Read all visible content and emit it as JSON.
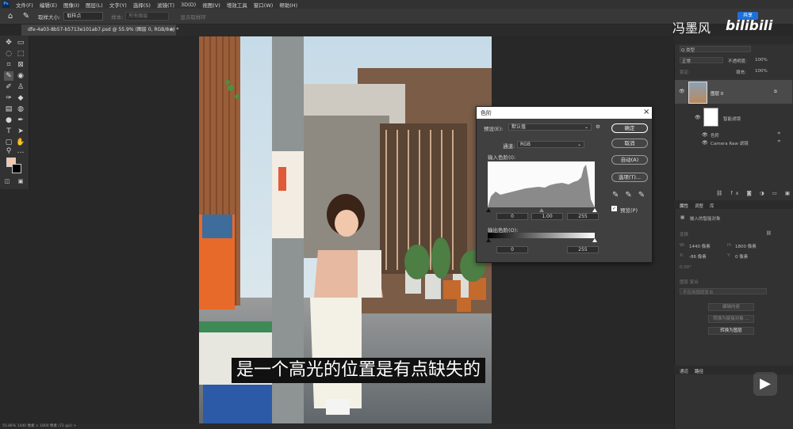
{
  "menubar": {
    "logo": "Ps",
    "items": [
      "文件(F)",
      "编辑(E)",
      "图像(I)",
      "图层(L)",
      "文字(Y)",
      "选择(S)",
      "滤镜(T)",
      "3D(D)",
      "视图(V)",
      "增效工具",
      "窗口(W)",
      "帮助(H)"
    ]
  },
  "options": {
    "sample_size_label": "取样大小:",
    "sample_size_value": "取样点",
    "sample_label": "样本:",
    "sample_value": "所有图层",
    "show_ring": "显示取样环"
  },
  "watermark": {
    "author": "冯墨风",
    "platform": "bilibili",
    "share": "共享"
  },
  "document": {
    "tab": "dfe-4a03-8b57-b5713e101ab7.psd @ 55.9% (图层 0, RGB/8#) *",
    "close": "×"
  },
  "subtitle": "是一个高光的位置是有点缺失的",
  "statusbar": "55.86%   1440 像素 × 1800 像素 (72 ppi)   >",
  "layers": {
    "search_label": "Q 类型",
    "blend_mode": "正常",
    "opacity_label": "不透明度:",
    "opacity_value": "100%",
    "lock_label": "锁定:",
    "fill_label": "填充:",
    "fill_value": "100%",
    "layer_name": "图层 0",
    "smart_filter": "智能滤镜",
    "filter_1": "色阶",
    "filter_2": "Camera Raw 滤镜"
  },
  "properties": {
    "tabs": [
      "属性",
      "调整",
      "库"
    ],
    "object_label": "嵌入的智能对象",
    "transform_label": "变换",
    "w_label": "W:",
    "w_value": "1440 像素",
    "h_label": "H:",
    "h_value": "1800 像素",
    "x_label": "X:",
    "x_value": "-86 像素",
    "y_label": "Y:",
    "y_value": "0 像素",
    "angle_value": "0.00°",
    "comp_label": "图层 复合",
    "comp_value": "不应用图层复合",
    "btn_edit": "编辑内容",
    "btn_convert_linked": "转换为链接对象 ...",
    "btn_convert_layer": "转换为图层"
  },
  "bottom_tabs": [
    "通道",
    "路径"
  ],
  "levels": {
    "title": "色阶",
    "close": "×",
    "preset_label": "预设(E):",
    "preset_value": "默认值",
    "channel_label": "通道:",
    "channel_value": "RGB",
    "input_label": "输入色阶(I):",
    "output_label": "输出色阶(O):",
    "in_black": "0",
    "in_gamma": "1.00",
    "in_white": "255",
    "out_black": "0",
    "out_white": "255",
    "btn_ok": "确定",
    "btn_cancel": "取消",
    "btn_auto": "自动(A)",
    "btn_options": "选项(T)...",
    "preview_label": "预览(P)",
    "preview_checked": true
  }
}
